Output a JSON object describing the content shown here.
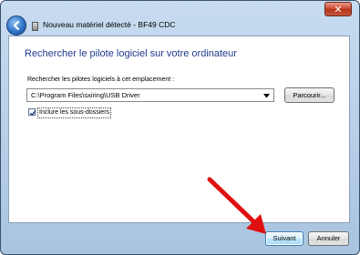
{
  "window": {
    "title": "Nouveau matériel détecté - BF49 CDC",
    "close_symbol": "✕",
    "icons": {
      "back": "back-arrow-icon",
      "hardware": "usb-device-icon",
      "close": "close-icon"
    }
  },
  "main": {
    "heading": "Rechercher le pilote logiciel sur votre ordinateur",
    "path_label": "Rechercher les pilotes logiciels à cet emplacement :",
    "path_value": "C:\\Program Files\\sxiring\\USB Driver",
    "browse_label": "Parcourir...",
    "include_subfolders": {
      "label": "Inclure les sous-dossiers",
      "checked": true
    }
  },
  "footer": {
    "next_label": "Suivant",
    "cancel_label": "Annuler"
  },
  "annotation": {
    "type": "red-arrow-pointing-to-next",
    "color": "#e01010"
  },
  "colors": {
    "heading": "#1e3a8a",
    "frame": "#b5cde6",
    "accent": "#3c7fb1"
  }
}
